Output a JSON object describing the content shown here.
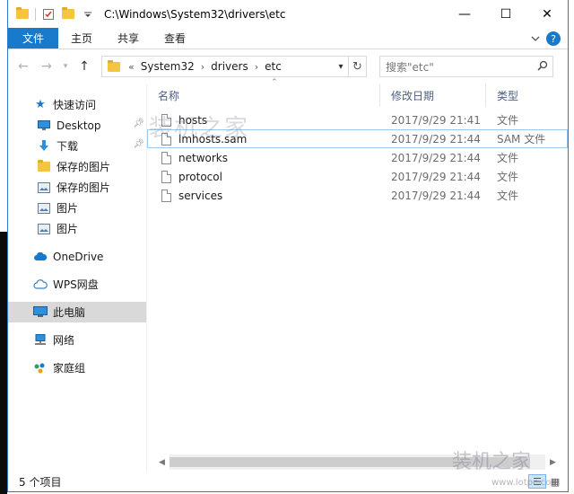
{
  "window": {
    "title": "C:\\Windows\\System32\\drivers\\etc",
    "controls": {
      "minimize": "—",
      "maximize": "☐",
      "close": "✕"
    }
  },
  "ribbon": {
    "tabs": [
      {
        "label": "文件",
        "active": true
      },
      {
        "label": "主页"
      },
      {
        "label": "共享"
      },
      {
        "label": "查看"
      }
    ],
    "help": "?"
  },
  "address": {
    "prefix": "«",
    "crumbs": [
      "System32",
      "drivers",
      "etc"
    ]
  },
  "search": {
    "placeholder": "搜索\"etc\""
  },
  "nav": {
    "items": [
      {
        "label": "快速访问",
        "icon": "star-icon",
        "color": "#1979ca"
      },
      {
        "label": "Desktop",
        "icon": "desktop-icon",
        "pinned": true,
        "sub": true
      },
      {
        "label": "下载",
        "icon": "download-icon",
        "pinned": true,
        "sub": true
      },
      {
        "label": "保存的图片",
        "icon": "folder-icon",
        "sub": true
      },
      {
        "label": "保存的图片",
        "icon": "picture-icon",
        "sub": true
      },
      {
        "label": "图片",
        "icon": "picture-icon",
        "sub": true
      },
      {
        "label": "图片",
        "icon": "picture-icon",
        "sub": true
      },
      {
        "label": "OneDrive",
        "icon": "cloud-icon"
      },
      {
        "label": "WPS网盘",
        "icon": "cloud-outline-icon"
      },
      {
        "label": "此电脑",
        "icon": "computer-icon",
        "selected": true
      },
      {
        "label": "网络",
        "icon": "network-icon"
      },
      {
        "label": "家庭组",
        "icon": "homegroup-icon"
      }
    ]
  },
  "columns": {
    "name": "名称",
    "date": "修改日期",
    "type": "类型"
  },
  "files": [
    {
      "name": "hosts",
      "date": "2017/9/29 21:41",
      "type": "文件"
    },
    {
      "name": "lmhosts.sam",
      "date": "2017/9/29 21:44",
      "type": "SAM 文件"
    },
    {
      "name": "networks",
      "date": "2017/9/29 21:44",
      "type": "文件"
    },
    {
      "name": "protocol",
      "date": "2017/9/29 21:44",
      "type": "文件"
    },
    {
      "name": "services",
      "date": "2017/9/29 21:44",
      "type": "文件"
    }
  ],
  "status": {
    "count": "5 个项目"
  },
  "watermark": {
    "text": "装机之家",
    "domain": "www.lotpc.com"
  },
  "colors": {
    "accent": "#1979ca",
    "selection": "#d9d9d9",
    "border": "#2b79d0"
  }
}
